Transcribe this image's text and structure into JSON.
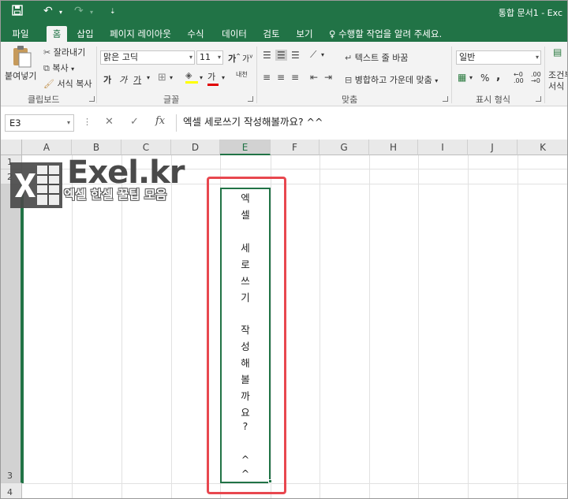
{
  "title": "통합 문서1 - Exc",
  "tabs": [
    "파일",
    "홈",
    "삽입",
    "페이지 레이아웃",
    "수식",
    "데이터",
    "검토",
    "보기"
  ],
  "tell_me": "수행할 작업을 알려 주세요.",
  "clipboard": {
    "paste": "붙여넣기",
    "cut": "잘라내기",
    "copy": "복사",
    "format_painter": "서식 복사",
    "group": "클립보드"
  },
  "font": {
    "name": "맑은 고딕",
    "size": "11",
    "grow": "가",
    "shrink": "가",
    "bold": "가",
    "italic": "가",
    "underline": "가",
    "color_letter": "가",
    "phonetic": "내천",
    "group": "글꼴"
  },
  "alignment": {
    "wrap_text": "텍스트 줄 바꿈",
    "merge_center": "병합하고 가운데 맞춤",
    "group": "맞춤"
  },
  "number": {
    "format": "일반",
    "percent": "%",
    "comma": ",",
    "group": "표시 형식"
  },
  "styles": {
    "conditional": "조건부",
    "conditional2": "서식"
  },
  "formula_bar": {
    "name_box": "E3",
    "fx": "fx",
    "content": "엑셀 세로쓰기 작성해볼까요? ^^"
  },
  "columns": [
    "A",
    "B",
    "C",
    "D",
    "E",
    "F",
    "G",
    "H",
    "I",
    "J",
    "K"
  ],
  "rows": [
    "1",
    "2",
    "3",
    "4"
  ],
  "cell_text": [
    "엑",
    "셀",
    "",
    "세",
    "로",
    "쓰",
    "기",
    "",
    "작",
    "성",
    "해",
    "볼",
    "까",
    "요",
    "?",
    "",
    "^",
    "^"
  ],
  "logo": {
    "title": "Exel.kr",
    "subtitle": "엑셀 한셀 꿀팁 모음"
  },
  "colors": {
    "accent": "#217346",
    "highlight": "#e8474f"
  }
}
